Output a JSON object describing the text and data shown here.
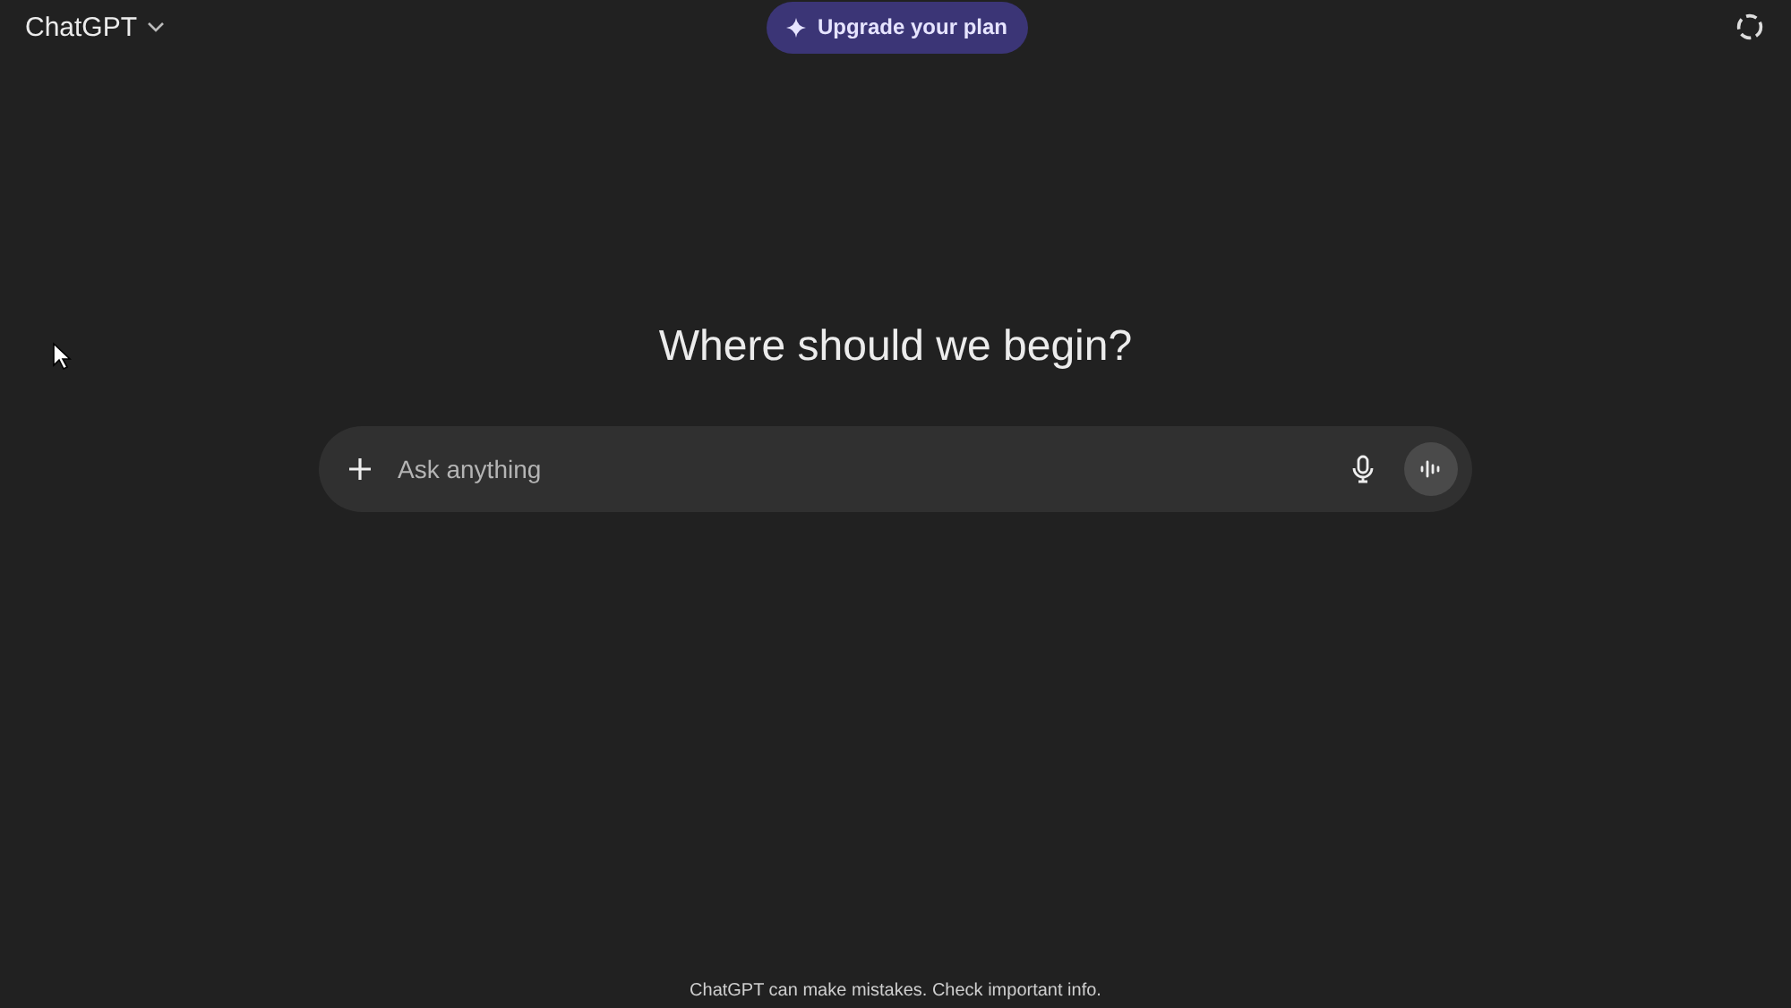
{
  "header": {
    "model_name": "ChatGPT",
    "upgrade_button": "Upgrade your plan"
  },
  "heading": "Where should we begin?",
  "composer": {
    "placeholder": "Ask anything"
  },
  "footer": "ChatGPT can make mistakes. Check important info."
}
